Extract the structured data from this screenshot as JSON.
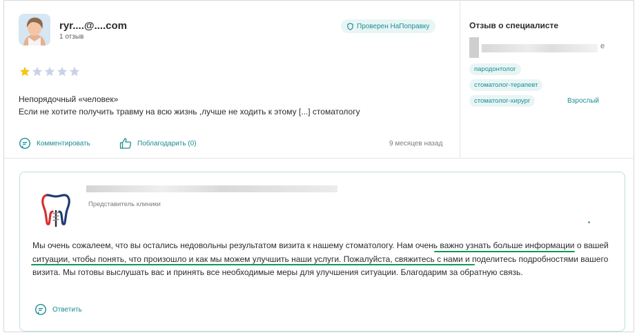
{
  "review": {
    "user_name": "ryr....@....com",
    "user_reviews_count": "1 отзыв",
    "verified_badge": "Проверен НаПоправку",
    "rating": 1,
    "rating_max": 5,
    "title": "Непорядочный «человек»",
    "text": "Если не хотите получить травму на всю жизнь ,лучше не ходить к этому [...] стоматологу",
    "comment_label": "Комментировать",
    "thank_label": "Поблагодарить (0)",
    "date": "9 месяцев назад"
  },
  "specialist": {
    "heading": "Отзыв о специалисте",
    "name_tail": "е",
    "tags": [
      "пародонтолог",
      "стоматолог-терапевт",
      "стоматолог-хирург"
    ],
    "age_group": "Взрослый"
  },
  "reply": {
    "role": "Представитель клиники",
    "text_before": "Мы очень сожалеем, что вы остались недовольны результатом визита к нашему стоматологу.",
    "text_highlight": "Нам очень важно узнать больше информации о вашей ситуации, чтобы понять, что произошло и как мы можем улучшить наши услуги.",
    "text_after": "Пожалуйста, свяжитесь с нами и поделитесь подробностями вашего визита. Мы готовы выслушать вас и принять все необходимые меры для улучшения ситуации. Благодарим за обратную связь.",
    "reply_label": "Ответить"
  },
  "colors": {
    "accent": "#1b8e93",
    "star_filled": "#f5c518",
    "star_empty": "#c9d3e6",
    "underline": "#0c9a4f"
  }
}
